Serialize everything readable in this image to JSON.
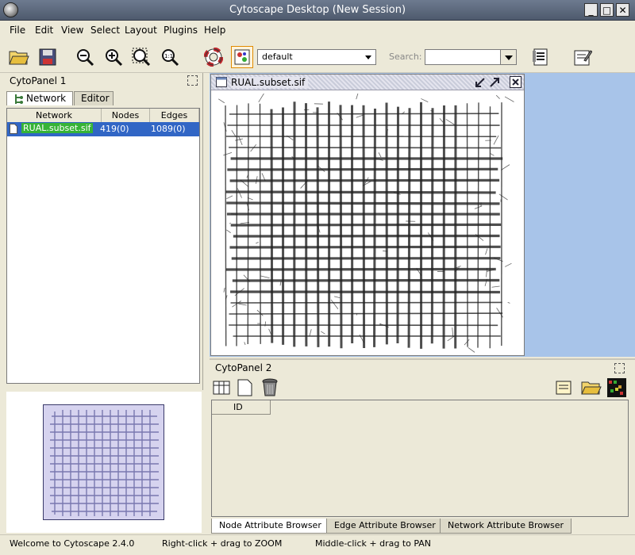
{
  "window": {
    "title": "Cytoscape Desktop (New Session)",
    "minimize": "_",
    "maximize": "□",
    "close": "✕"
  },
  "menu": [
    "File",
    "Edit",
    "View",
    "Select",
    "Layout",
    "Plugins",
    "Help"
  ],
  "toolbar": {
    "visual_style": "default",
    "search_label": "Search:",
    "search_value": ""
  },
  "cytopanel1": {
    "title": "CytoPanel 1",
    "tabs": [
      "Network",
      "Editor"
    ],
    "active_tab": "Network",
    "table": {
      "headers": [
        "Network",
        "Nodes",
        "Edges"
      ],
      "rows": [
        {
          "network": "RUAL.subset.sif",
          "nodes": "419(0)",
          "edges": "1089(0)"
        }
      ]
    }
  },
  "network_view": {
    "title": "RUAL.subset.sif"
  },
  "cytopanel2": {
    "title": "CytoPanel 2",
    "column_header": "ID",
    "tabs": [
      "Node Attribute Browser",
      "Edge Attribute Browser",
      "Network Attribute Browser"
    ],
    "active_tab": "Node Attribute Browser"
  },
  "status": {
    "welcome": "Welcome to Cytoscape 2.4.0",
    "zoom_hint": "Right-click + drag  to  ZOOM",
    "pan_hint": "Middle-click + drag  to  PAN"
  },
  "colors": {
    "selection_blue": "#3166c5",
    "highlight_green": "#36b336",
    "desktop_blue": "#a8c4e9",
    "overview_fill": "#d6d3ef"
  }
}
